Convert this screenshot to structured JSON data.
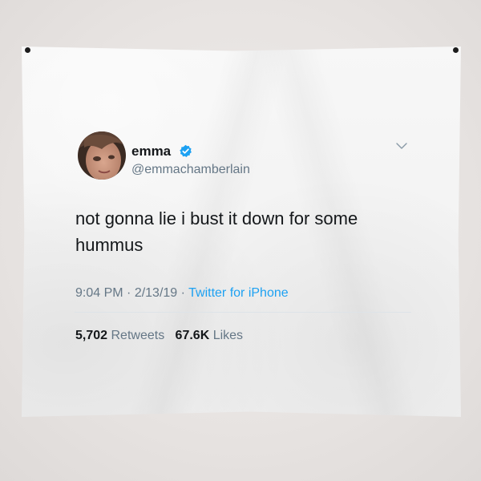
{
  "tweet": {
    "display_name": "emma",
    "handle": "@emmachamberlain",
    "verified_icon": "verified-badge-icon",
    "menu_icon": "chevron-down-icon",
    "text": "not gonna lie i bust it down for some hummus",
    "time": "9:04 PM",
    "separator": " · ",
    "date": "2/13/19",
    "source": "Twitter for iPhone",
    "retweets_count": "5,702",
    "retweets_label": "Retweets",
    "likes_count": "67.6K",
    "likes_label": "Likes"
  },
  "colors": {
    "wall": "#e9e6e4",
    "tapestry": "#f5f5f5",
    "text_primary": "#14171a",
    "text_secondary": "#657786",
    "twitter_blue": "#1da1f2"
  }
}
